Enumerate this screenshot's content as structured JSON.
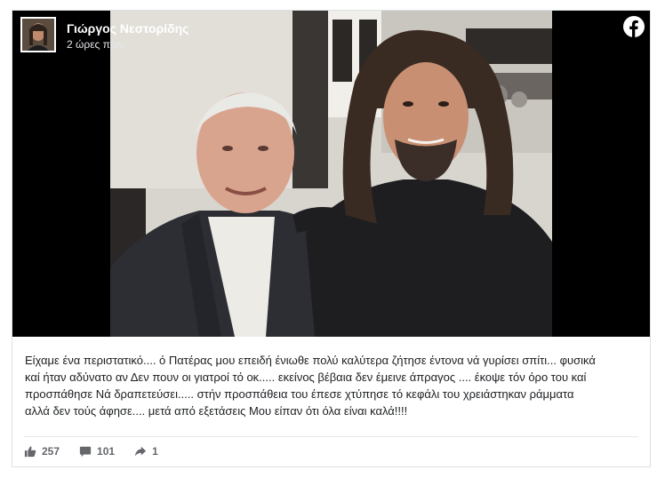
{
  "post": {
    "author": "Γιώργος Νεστορίδης",
    "time": "2 ώρες πριν",
    "caption_lines": [
      "Είχαμε ένα περιστατικό.... ό Πατέρας μου επειδή ένιωθε πολύ καλύτερα ζήτησε έντονα νά γυρίσει σπίτι... φυσικά",
      "καί ήταν αδύνατο αν Δεν πουν οι γιατροί τό οκ..... εκείνος βέβαια δεν έμεινε άπραγος .... έκοψε τόν όρο του καί",
      "προσπάθησε Νά δραπετεύσει..... στήν προσπάθεια του έπεσε χτύπησε τό κεφάλι του χρειάστηκαν ράμματα",
      "αλλά δεν τούς άφησε.... μετά από εξετάσεις Μου είπαν ότι όλα είναι καλά!!!!"
    ]
  },
  "stats": {
    "likes": "257",
    "comments": "101",
    "shares": "1"
  },
  "icons": {
    "platform": "facebook-icon",
    "like": "thumbs-up-icon",
    "comment": "comment-bubble-icon",
    "share": "share-arrow-icon"
  },
  "colors": {
    "media_background": "#000000",
    "text": "#1c1e21",
    "meta_text": "#65676b",
    "border": "#dddfe2"
  }
}
